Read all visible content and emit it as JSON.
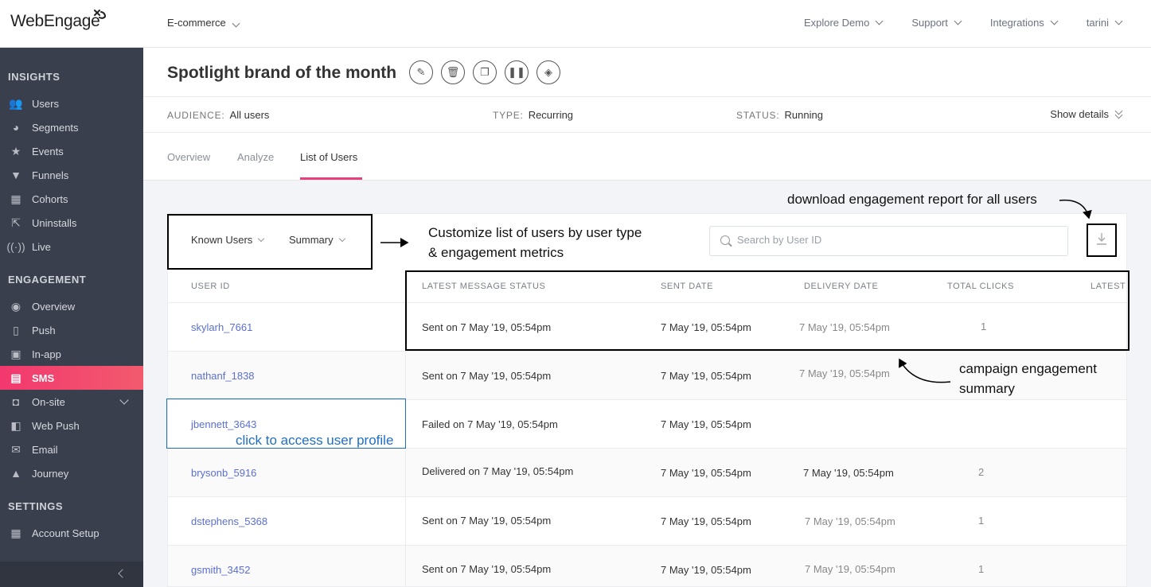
{
  "brand": {
    "logo_text": "WebEngage"
  },
  "header": {
    "project": "E-commerce",
    "nav": [
      "Explore Demo",
      "Support",
      "Integrations",
      "tarini"
    ]
  },
  "sidebar": {
    "sections": {
      "insights": "INSIGHTS",
      "engagement": "ENGAGEMENT",
      "settings": "SETTINGS"
    },
    "insights": [
      {
        "label": "Users",
        "icon": "users-icon"
      },
      {
        "label": "Segments",
        "icon": "pie-icon"
      },
      {
        "label": "Events",
        "icon": "star-icon"
      },
      {
        "label": "Funnels",
        "icon": "funnel-icon"
      },
      {
        "label": "Cohorts",
        "icon": "grid-icon"
      },
      {
        "label": "Uninstalls",
        "icon": "uninstall-icon"
      },
      {
        "label": "Live",
        "icon": "live-icon"
      }
    ],
    "engagement": [
      {
        "label": "Overview",
        "icon": "eye-icon"
      },
      {
        "label": "Push",
        "icon": "push-icon"
      },
      {
        "label": "In-app",
        "icon": "inapp-icon"
      },
      {
        "label": "SMS",
        "icon": "sms-icon"
      },
      {
        "label": "On-site",
        "icon": "onsite-icon"
      },
      {
        "label": "Web Push",
        "icon": "webpush-icon"
      },
      {
        "label": "Email",
        "icon": "email-icon"
      },
      {
        "label": "Journey",
        "icon": "rocket-icon"
      }
    ],
    "settings": [
      {
        "label": "Account Setup",
        "icon": "grid-icon"
      }
    ],
    "active_color": "#f2386f"
  },
  "campaign": {
    "title": "Spotlight brand of the month",
    "actions": [
      "edit-icon",
      "delete-icon",
      "copy-icon",
      "pause-icon",
      "tag-icon"
    ],
    "audience_key": "AUDIENCE:",
    "audience": "All users",
    "type_key": "TYPE:",
    "type": "Recurring",
    "status_key": "STATUS:",
    "status": "Running",
    "show_details": "Show details"
  },
  "tabs": [
    "Overview",
    "Analyze",
    "List of Users"
  ],
  "filters": {
    "user_type": "Known Users",
    "view": "Summary",
    "search_placeholder": "Search by User ID"
  },
  "table": {
    "headers": [
      "USER ID",
      "LATEST MESSAGE STATUS",
      "SENT DATE",
      "DELIVERY DATE",
      "TOTAL CLICKS",
      "LATEST"
    ],
    "rows": [
      {
        "user": "skylarh_7661",
        "status": "Sent on 7 May '19, 05:54pm",
        "sent": "7 May '19, 05:54pm",
        "delivery": "7 May '19, 05:54pm",
        "clicks": "1"
      },
      {
        "user": "nathanf_1838",
        "status": "Sent on 7 May '19, 05:54pm",
        "sent": "7 May '19, 05:54pm",
        "delivery": "7 May '19, 05:54pm",
        "clicks": ""
      },
      {
        "user": "jbennett_3643",
        "status": "Failed on 7 May '19, 05:54pm",
        "sent": "7 May '19, 05:54pm",
        "delivery": "",
        "clicks": ""
      },
      {
        "user": "brysonb_5916",
        "status": "Delivered on 7 May '19, 05:54pm",
        "sent": "7 May '19, 05:54pm",
        "delivery": "7 May '19, 05:54pm",
        "clicks": "2"
      },
      {
        "user": "dstephens_5368",
        "status": "Sent on 7 May '19, 05:54pm",
        "sent": "7 May '19, 05:54pm",
        "delivery": "7 May '19, 05:54pm",
        "clicks": "1"
      },
      {
        "user": "gsmith_3452",
        "status": "Sent on 7 May '19, 05:54pm",
        "sent": "7 May '19, 05:54pm",
        "delivery": "7 May '19, 05:54pm",
        "clicks": "1"
      }
    ]
  },
  "annotations": {
    "download": "download engagement report for all users",
    "customize_1": "Customize list of users by user type",
    "customize_2": "& engagement metrics",
    "summary_1": "campaign engagement",
    "summary_2": "summary",
    "profile": "click to access user profile"
  }
}
